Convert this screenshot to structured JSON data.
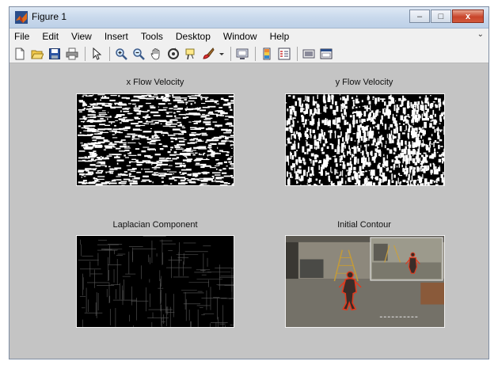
{
  "window": {
    "title": "Figure 1",
    "minimize_glyph": "–",
    "maximize_glyph": "□",
    "close_glyph": "x"
  },
  "menu": {
    "items": [
      "File",
      "Edit",
      "View",
      "Insert",
      "Tools",
      "Desktop",
      "Window",
      "Help"
    ],
    "overflow_glyph": "⌄"
  },
  "toolbar": {
    "buttons": [
      "new-figure-icon",
      "open-file-icon",
      "save-icon",
      "print-icon",
      "pointer-icon",
      "zoom-in-icon",
      "zoom-out-icon",
      "pan-icon",
      "rotate-3d-icon",
      "data-cursor-icon",
      "brush-icon",
      "brush-dropdown-icon",
      "link-plot-icon",
      "colorbar-icon",
      "legend-icon",
      "hide-plot-tools-icon",
      "show-plot-tools-icon"
    ]
  },
  "axes": [
    {
      "title": "x Flow Velocity",
      "content": "binary-noise"
    },
    {
      "title": "y Flow Velocity",
      "content": "binary-noise"
    },
    {
      "title": "Laplacian Component",
      "content": "edge-map"
    },
    {
      "title": "Initial Contour",
      "content": "video-frame"
    }
  ],
  "colors": {
    "figure_background": "#c4c4c4",
    "contour": "#e03a1e",
    "title_bar": "#c9d9ec"
  }
}
